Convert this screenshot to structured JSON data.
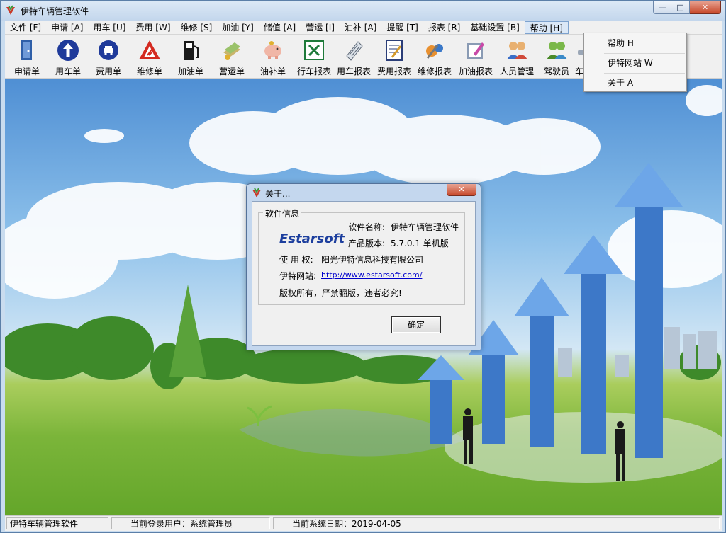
{
  "window": {
    "title": "伊特车辆管理软件",
    "controls": {
      "minimize": "—",
      "maximize": "□",
      "close": "✕"
    }
  },
  "menu": [
    "文件 [F]",
    "申请 [A]",
    "用车 [U]",
    "费用 [W]",
    "维修 [S]",
    "加油 [Y]",
    "储值 [A]",
    "营运 [I]",
    "油补 [A]",
    "提醒 [T]",
    "报表 [R]",
    "基础设置 [B]",
    "帮助 [H]"
  ],
  "toolbar": [
    {
      "label": "申请单",
      "icon": "door-icon"
    },
    {
      "label": "用车单",
      "icon": "up-arrow-icon"
    },
    {
      "label": "费用单",
      "icon": "car-icon"
    },
    {
      "label": "维修单",
      "icon": "road-sign-icon"
    },
    {
      "label": "加油单",
      "icon": "fuel-pump-icon"
    },
    {
      "label": "营运单",
      "icon": "money-icon"
    },
    {
      "label": "油补单",
      "icon": "piggy-bank-icon"
    },
    {
      "label": "行车报表",
      "icon": "excel-icon"
    },
    {
      "label": "用车报表",
      "icon": "scroll-icon"
    },
    {
      "label": "费用报表",
      "icon": "notebook-icon"
    },
    {
      "label": "维修报表",
      "icon": "tools-icon"
    },
    {
      "label": "加油报表",
      "icon": "edit-icon"
    },
    {
      "label": "人员管理",
      "icon": "users-icon"
    },
    {
      "label": "驾驶员",
      "icon": "driver-icon"
    },
    {
      "label": "车",
      "icon": "car-partial-icon"
    }
  ],
  "help_menu": [
    {
      "label": "帮助 H"
    },
    {
      "label": "伊特网站 W"
    },
    {
      "label": "关于 A"
    }
  ],
  "about": {
    "title": "关于...",
    "close": "✕",
    "group_label": "软件信息",
    "brand": "Estarsoft",
    "software_name_label": "软件名称:",
    "software_name": "伊特车辆管理软件",
    "version_label": "产品版本:",
    "version": "5.7.0.1 单机版",
    "license_label": "使 用 权:",
    "license": "阳光伊特信息科技有限公司",
    "website_label": "伊特网站:",
    "website": "http://www.estarsoft.com/",
    "copyright": "版权所有，严禁翻版，违者必究!",
    "ok": "确定"
  },
  "status": {
    "app_name": "伊特车辆管理软件",
    "user_label": "当前登录用户：",
    "user": "系统管理员",
    "date_label": "当前系统日期：",
    "date": "2019-04-05"
  },
  "colors": {
    "accent": "#1d3f9e",
    "link": "#0000cc",
    "close_red": "#c7482a",
    "frame": "#c9dcef"
  }
}
